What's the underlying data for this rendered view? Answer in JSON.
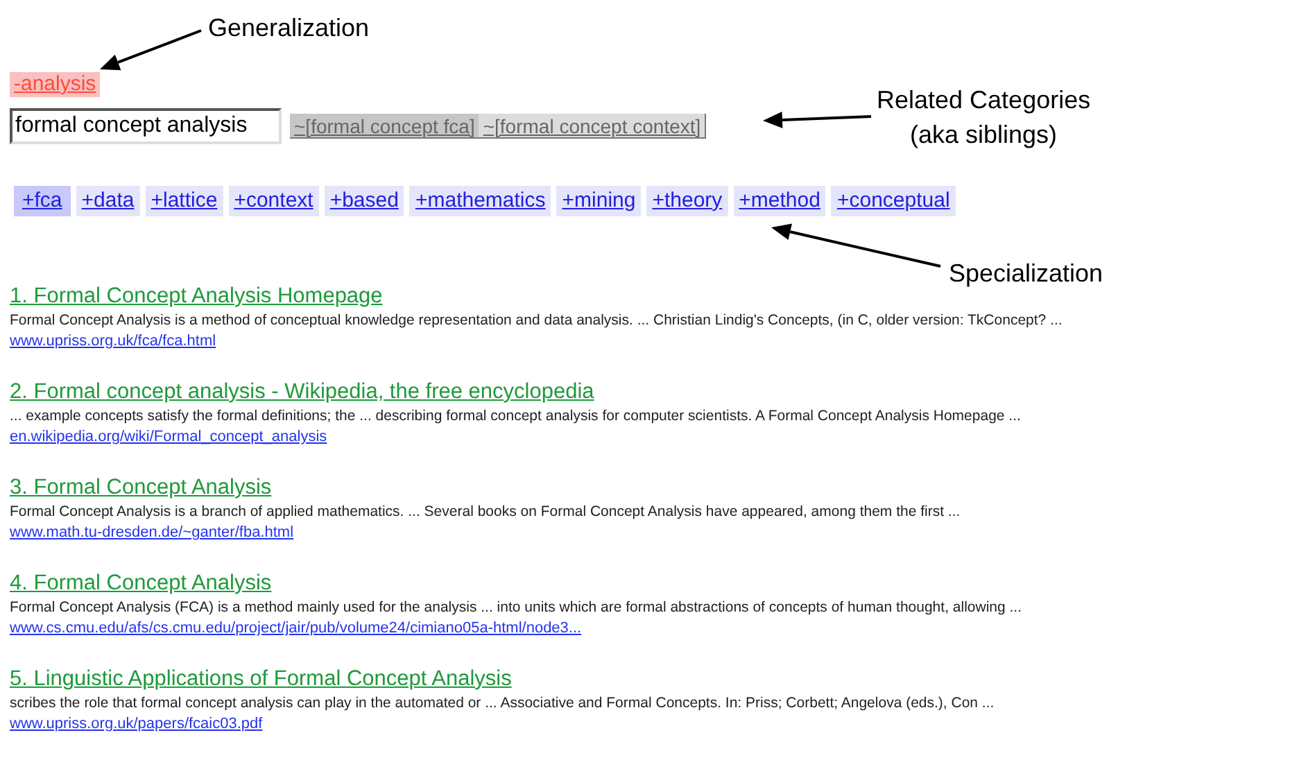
{
  "annotations": [
    {
      "kind": "generalization",
      "lines": [
        "Generalization"
      ]
    },
    {
      "kind": "siblings",
      "lines": [
        "Related Categories",
        "(aka siblings)"
      ]
    },
    {
      "kind": "specialization",
      "lines": [
        "Specialization"
      ]
    }
  ],
  "generalization": {
    "label": "-analysis"
  },
  "search": {
    "value": "formal concept analysis"
  },
  "siblings": [
    {
      "label": "~[formal concept fca]",
      "selected": true
    },
    {
      "label": "~[formal concept context]",
      "selected": false
    }
  ],
  "specializations": [
    {
      "label": "+fca",
      "selected": true
    },
    {
      "label": "+data",
      "selected": false
    },
    {
      "label": "+lattice",
      "selected": false
    },
    {
      "label": "+context",
      "selected": false
    },
    {
      "label": "+based",
      "selected": false
    },
    {
      "label": "+mathematics",
      "selected": false
    },
    {
      "label": "+mining",
      "selected": false
    },
    {
      "label": "+theory",
      "selected": false
    },
    {
      "label": "+method",
      "selected": false
    },
    {
      "label": "+conceptual",
      "selected": false
    }
  ],
  "results": [
    {
      "title": "1. Formal Concept Analysis Homepage",
      "snippet": "Formal Concept Analysis is a method of conceptual knowledge representation and data analysis. ... Christian Lindig's Concepts, (in C, older version: TkConcept? ...",
      "url": "www.upriss.org.uk/fca/fca.html"
    },
    {
      "title": "2. Formal concept analysis - Wikipedia, the free encyclopedia",
      "snippet": "... example concepts satisfy the formal definitions; the ... describing formal concept analysis for computer scientists. A Formal Concept Analysis Homepage ...",
      "url": "en.wikipedia.org/wiki/Formal_concept_analysis"
    },
    {
      "title": "3. Formal Concept Analysis",
      "snippet": "Formal Concept Analysis is a branch of applied mathematics. ... Several books on Formal Concept Analysis have appeared, among them the first ...",
      "url": "www.math.tu-dresden.de/~ganter/fba.html"
    },
    {
      "title": "4. Formal Concept Analysis",
      "snippet": "Formal Concept Analysis (FCA) is a method mainly used for the analysis ... into units which are formal abstractions of concepts of human thought, allowing ...",
      "url": "www.cs.cmu.edu/afs/cs.cmu.edu/project/jair/pub/volume24/cimiano05a-html/node3..."
    },
    {
      "title": "5. Linguistic Applications of Formal Concept Analysis",
      "snippet": "scribes the role that formal concept analysis can play in the automated or ... Associative and Formal Concepts. In: Priss; Corbett; Angelova (eds.), Con ...",
      "url": "www.upriss.org.uk/papers/fcaic03.pdf"
    }
  ]
}
